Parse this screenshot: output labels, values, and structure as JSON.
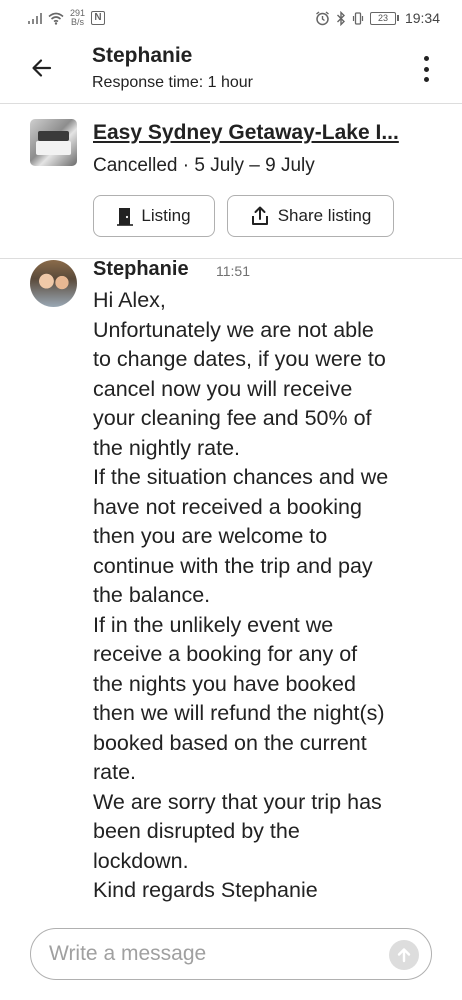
{
  "status_bar": {
    "net_speed_value": "291",
    "net_speed_unit": "B/s",
    "nfc_label": "N",
    "battery_level": "23",
    "time": "19:34"
  },
  "header": {
    "title": "Stephanie",
    "subtitle": "Response time: 1 hour"
  },
  "listing": {
    "title": "Easy Sydney Getaway-Lake I...",
    "status": "Cancelled · 5 July – 9 July",
    "listing_button_label": "Listing",
    "share_button_label": "Share listing"
  },
  "message": {
    "sender": "Stephanie",
    "time": "11:51",
    "lines": [
      "Hi Alex,",
      "Unfortunately we are not able",
      "to change dates, if you were to",
      "cancel now you will receive",
      "your cleaning fee and 50% of",
      "the nightly rate.",
      "If the situation chances and we",
      "have not received a booking",
      "then you are welcome to",
      "continue with the trip and pay",
      "the balance.",
      "If in the unlikely event we",
      "receive a booking for any of",
      "the nights you have booked",
      "then we will refund the night(s)",
      "booked based on the current",
      "rate.",
      "We are sorry that your trip has",
      "been disrupted by the",
      "lockdown.",
      "Kind regards Stephanie"
    ]
  },
  "composer": {
    "placeholder": "Write a message",
    "value": ""
  }
}
